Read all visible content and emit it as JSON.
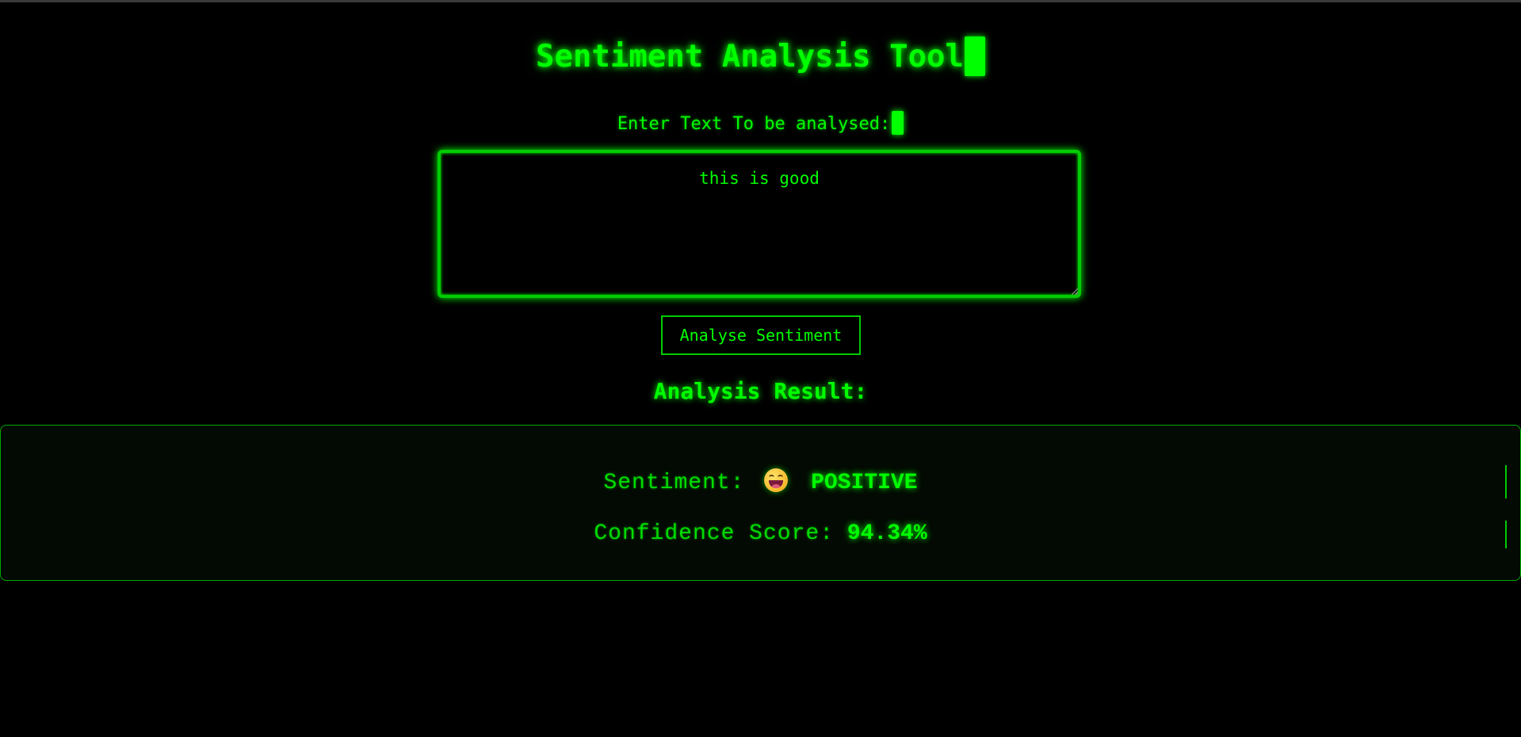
{
  "app": {
    "title": "Sentiment Analysis Tool",
    "accent_color": "#00ff00",
    "background_color": "#000000"
  },
  "input": {
    "label": "Enter Text To be analysed:",
    "value": "this is good"
  },
  "actions": {
    "analyse_label": "Analyse Sentiment"
  },
  "result": {
    "heading": "Analysis Result:",
    "sentiment_label": "Sentiment:",
    "sentiment_icon": "grinning-face-emoji-icon",
    "sentiment_value": "POSITIVE",
    "confidence_label": "Confidence Score:",
    "confidence_value": "94.34%"
  }
}
